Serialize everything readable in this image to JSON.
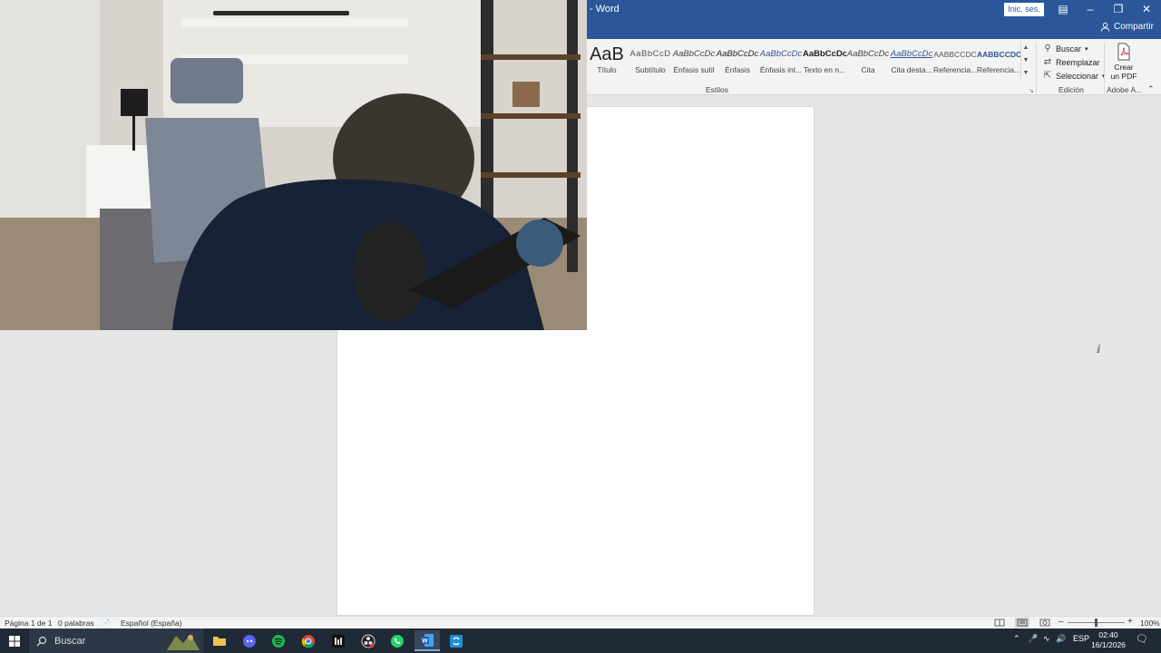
{
  "window": {
    "title": "- Word",
    "signin_label": "Inic. ses.",
    "share_label": "Compartir"
  },
  "ribbon": {
    "styles": [
      {
        "preview": "AaB",
        "label": "Título"
      },
      {
        "preview": "AaBbCcD",
        "label": "Subtítulo"
      },
      {
        "preview": "AaBbCcDc",
        "label": "Énfasis sutil"
      },
      {
        "preview": "AaBbCcDc",
        "label": "Énfasis"
      },
      {
        "preview": "AaBbCcDc",
        "label": "Énfasis int..."
      },
      {
        "preview": "AaBbCcDc",
        "label": "Texto en n..."
      },
      {
        "preview": "AaBbCcDc",
        "label": "Cita"
      },
      {
        "preview": "AaBbCcDc",
        "label": "Cita desta..."
      },
      {
        "preview": "AABBCCDC",
        "label": "Referencia..."
      },
      {
        "preview": "AABBCCDC",
        "label": "Referencia..."
      }
    ],
    "styles_group": "Estilos",
    "edit": {
      "find": "Buscar",
      "replace": "Reemplazar",
      "select": "Seleccionar",
      "group": "Edición"
    },
    "pdf": {
      "line1": "Crear",
      "line2": "un PDF",
      "group": "Adobe A..."
    }
  },
  "status": {
    "page": "Página 1 de 1",
    "words": "0 palabras",
    "language": "Español (España)",
    "zoom": "100%"
  },
  "taskbar": {
    "search_placeholder": "Buscar",
    "lang": "ESP",
    "time": "02:40",
    "date": "16/1/2026"
  }
}
